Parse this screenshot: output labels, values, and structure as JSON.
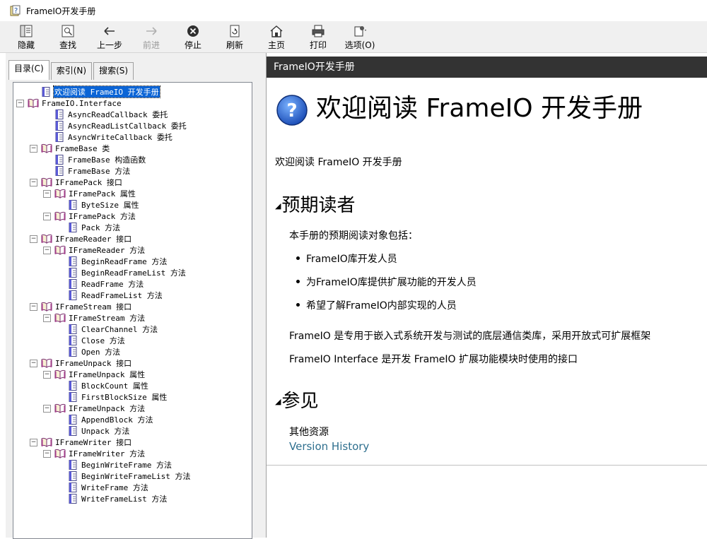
{
  "window": {
    "title": "FrameIO开发手册"
  },
  "toolbar": {
    "hide": "隐藏",
    "find": "查找",
    "back": "上一步",
    "forward": "前进",
    "stop": "停止",
    "refresh": "刷新",
    "home": "主页",
    "print": "打印",
    "options": "选项(O)"
  },
  "tabs": {
    "contents": "目录(C)",
    "index": "索引(N)",
    "search": "搜索(S)"
  },
  "tree": [
    "欢迎阅读 FrameIO 开发手册",
    "FrameIO.Interface",
    "AsyncReadCallback 委托",
    "AsyncReadListCallback 委托",
    "AsyncWriteCallback 委托",
    "FrameBase 类",
    "FrameBase 构造函数",
    "FrameBase 方法",
    "IFramePack 接口",
    "IFramePack 属性",
    "ByteSize 属性",
    "IFramePack 方法",
    "Pack 方法",
    "IFrameReader 接口",
    "IFrameReader 方法",
    "BeginReadFrame 方法",
    "BeginReadFrameList 方法",
    "ReadFrame 方法",
    "ReadFrameList 方法",
    "IFrameStream 接口",
    "IFrameStream 方法",
    "ClearChannel 方法",
    "Close 方法",
    "Open 方法",
    "IFrameUnpack 接口",
    "IFrameUnpack 属性",
    "BlockCount 属性",
    "FirstBlockSize 属性",
    "IFrameUnpack 方法",
    "AppendBlock 方法",
    "Unpack 方法",
    "IFrameWriter 接口",
    "IFrameWriter 方法",
    "BeginWriteFrame 方法",
    "BeginWriteFrameList 方法",
    "WriteFrame 方法",
    "WriteFrameList 方法"
  ],
  "topic": {
    "bar_title": "FrameIO开发手册",
    "title": "欢迎阅读 FrameIO 开发手册",
    "intro": "欢迎阅读 FrameIO 开发手册",
    "audience_heading": "预期读者",
    "audience_lead": "本手册的预期阅读对象包括：",
    "audience_items": [
      "FrameIO库开发人员",
      "为FrameIO库提供扩展功能的开发人员",
      "希望了解FrameIO内部实现的人员"
    ],
    "desc1": "FrameIO 是专用于嵌入式系统开发与测试的底层通信类库，采用开放式可扩展框架",
    "desc2": "FrameIO Interface 是开发 FrameIO 扩展功能模块时使用的接口",
    "seealso_heading": "参见",
    "other_resources": "其他资源",
    "version_link": "Version History"
  },
  "colors": {
    "topic_bar": "#333333",
    "link": "#2e6f8e",
    "selection": "#0a64d6"
  }
}
